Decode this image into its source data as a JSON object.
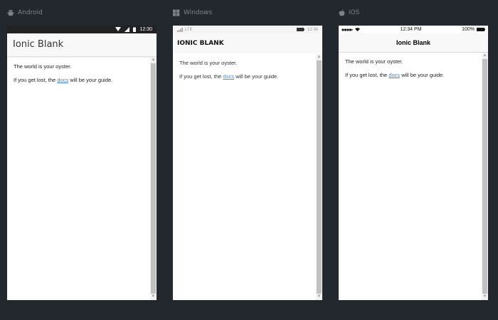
{
  "platforms": {
    "android": {
      "label": "Android",
      "icon": "android-icon",
      "status_time": "12:30",
      "title": "Ionic Blank"
    },
    "windows": {
      "label": "Windows",
      "icon": "windows-icon",
      "status_network": "LTE",
      "status_time": "12:34",
      "title": "IONIC BLANK"
    },
    "ios": {
      "label": "iOS",
      "icon": "apple-icon",
      "status_time": "12:34 PM",
      "status_battery": "100%",
      "title": "Ionic Blank"
    }
  },
  "content": {
    "line1": "The world is your oyster.",
    "line2_prefix": "If you get lost, the ",
    "link_text": "docs",
    "line2_suffix": " will be your guide."
  },
  "colors": {
    "background": "#23272e",
    "link": "#387ef5",
    "label": "#7d838d"
  },
  "scroll": {
    "android_thumb_fraction": 1.0,
    "windows_thumb_fraction": 1.0,
    "ios_thumb_fraction": 1.0
  }
}
